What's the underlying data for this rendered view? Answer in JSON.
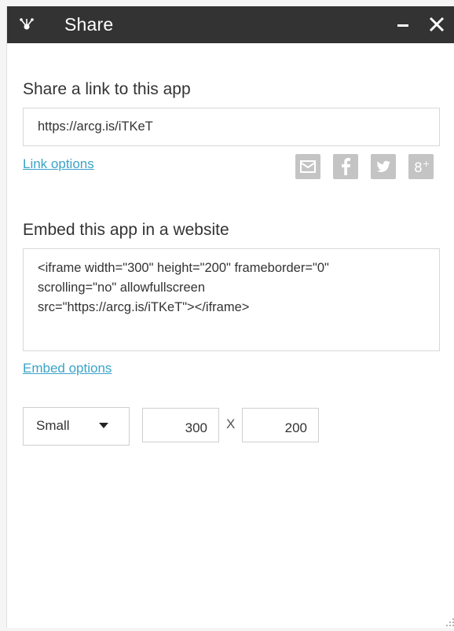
{
  "window": {
    "title": "Share",
    "app_icon": "share-app-icon",
    "minimize_icon": "minimize-icon",
    "close_icon": "close-icon"
  },
  "link_section": {
    "title": "Share a link to this app",
    "url": "https://arcg.is/iTKeT",
    "options_label": "Link options",
    "share_icons": [
      "email-icon",
      "facebook-icon",
      "twitter-icon",
      "google-plus-icon"
    ]
  },
  "embed_section": {
    "title": "Embed this app in a website",
    "code_lines": [
      "<iframe width=\"300\" height=\"200\" frameborder=\"0\"",
      "scrolling=\"no\" allowfullscreen",
      "src=\"https://arcg.is/iTKeT\"></iframe>"
    ],
    "options_label": "Embed options",
    "size_select": "Small",
    "width": "300",
    "separator": "X",
    "height": "200"
  },
  "colors": {
    "titlebar": "#333333",
    "link": "#3aa3c9",
    "icon_bg": "#c4c4c4"
  }
}
